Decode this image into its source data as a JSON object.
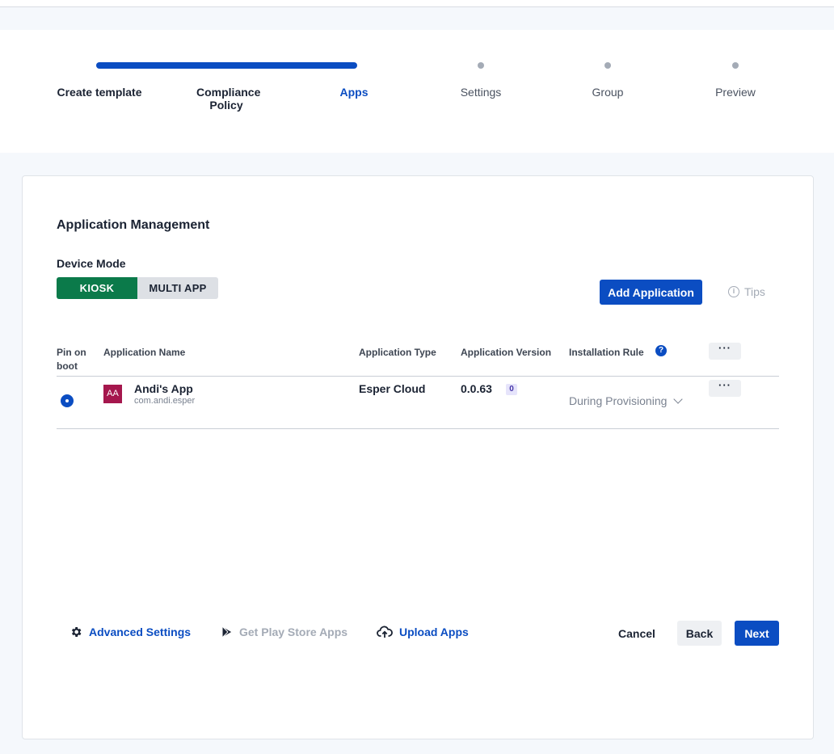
{
  "stepper": {
    "steps": [
      {
        "label": "Create template",
        "state": "done"
      },
      {
        "label": "Compliance Policy",
        "state": "done"
      },
      {
        "label": "Apps",
        "state": "active"
      },
      {
        "label": "Settings",
        "state": "pending"
      },
      {
        "label": "Group",
        "state": "pending"
      },
      {
        "label": "Preview",
        "state": "pending"
      }
    ]
  },
  "main": {
    "title": "Application Management",
    "device_mode_label": "Device Mode",
    "modes": [
      {
        "label": "KIOSK",
        "selected": true
      },
      {
        "label": "MULTI APP",
        "selected": false
      }
    ],
    "add_application_label": "Add Application",
    "tips_label": "Tips"
  },
  "table": {
    "headers": {
      "pin": "Pin on boot",
      "name": "Application Name",
      "type": "Application Type",
      "version": "Application Version",
      "rule": "Installation Rule"
    },
    "more_label": "···",
    "help_label": "?",
    "rows": [
      {
        "icon_text": "AA",
        "name": "Andi's App",
        "package": "com.andi.esper",
        "type": "Esper Cloud",
        "version": "0.0.63",
        "version_badge": "0",
        "rule": "During Provisioning",
        "pinned": true
      }
    ]
  },
  "footer": {
    "advanced_settings": "Advanced Settings",
    "play_store": "Get Play Store Apps",
    "upload_apps": "Upload Apps",
    "cancel": "Cancel",
    "back": "Back",
    "next": "Next"
  },
  "colors": {
    "primary": "#0b4dc2",
    "kiosk_green": "#0b7a4a",
    "app_icon_bg": "#a5174d"
  }
}
